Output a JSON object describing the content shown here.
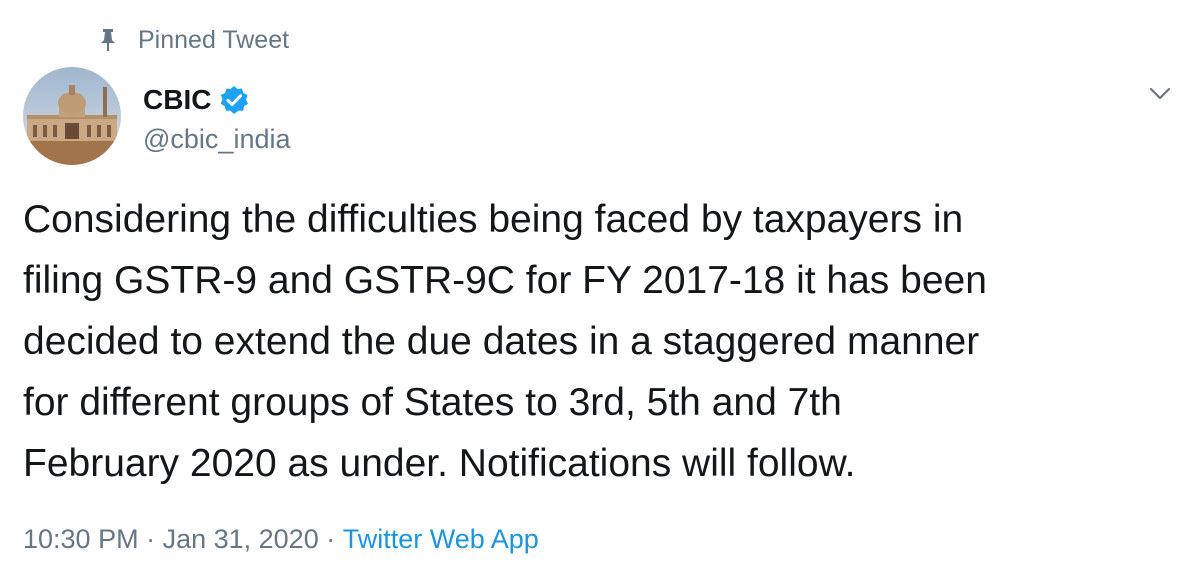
{
  "pinned": {
    "label": "Pinned Tweet",
    "icon": "pin-icon"
  },
  "author": {
    "name": "CBIC",
    "handle": "@cbic_india",
    "verified": true,
    "verified_color": "#1da1f2",
    "avatar_icon": "building-avatar"
  },
  "menu": {
    "icon": "chevron-down-icon"
  },
  "tweet": {
    "text": "Considering the difficulties being faced by taxpayers in\nfiling GSTR-9 and GSTR-9C for FY 2017-18 it has been\ndecided to extend the due dates in a staggered manner\nfor different groups of States to 3rd, 5th and 7th\nFebruary 2020 as under. Notifications will follow."
  },
  "meta": {
    "time": "10:30 PM",
    "sep1": " · ",
    "date": "Jan 31, 2020",
    "sep2": " · ",
    "source": "Twitter Web App",
    "link_color": "#1b95e0"
  }
}
